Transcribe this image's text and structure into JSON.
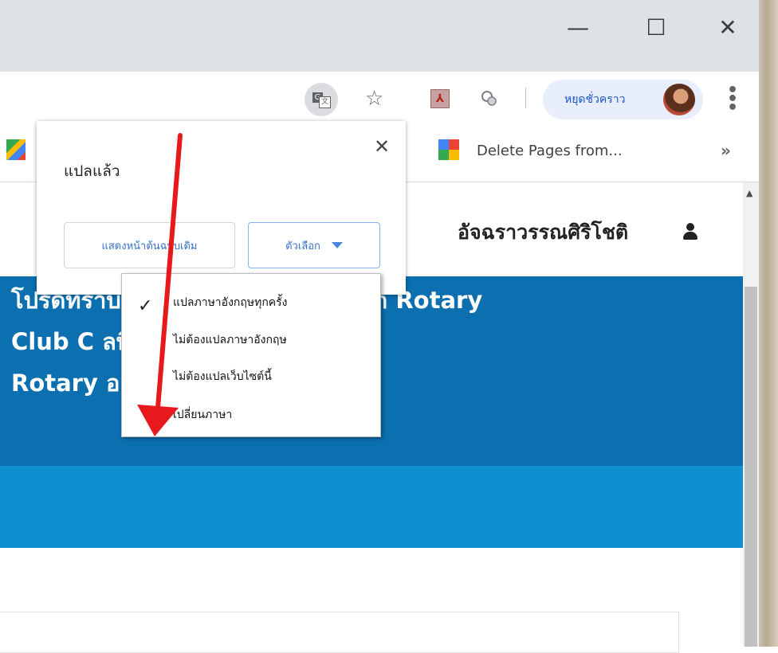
{
  "window": {
    "minimize_glyph": "—",
    "maximize_glyph": "☐",
    "close_glyph": "✕"
  },
  "toolbar": {
    "translate_icon_text_a": "G",
    "translate_icon_text_b": "文",
    "bookmark_star": "☆",
    "pdf_icon_text": "⅄",
    "profile_label": "หยุดชั่วคราว",
    "menu_glyph": "⋮"
  },
  "bookmarks": {
    "item_label": "Delete Pages from...",
    "more_glyph": "»"
  },
  "page": {
    "user_name": "อัจฉราวรรณศิริโชติ",
    "banner_lines": [
      "โปรดทราบว่าข้อมูลจากแหล่งภายนอก Rotary",
      "Club C                          ลที่รายงานใน My",
      "Rotary                         อย่างน้อย 24 ชั่วโมง"
    ],
    "scroll_up_glyph": "▲"
  },
  "translate_bubble": {
    "title": "แปลแล้ว",
    "close_glyph": "✕",
    "show_original_label": "แสดงหน้าต้นฉบับเดิม",
    "options_label": "ตัวเลือก"
  },
  "options_menu": {
    "check_glyph": "✓",
    "items": [
      "แปลภาษาอังกฤษทุกครั้ง",
      "ไม่ต้องแปลภาษาอังกฤษ",
      "ไม่ต้องแปลเว็บไซต์นี้",
      "เปลี่ยนภาษา"
    ],
    "checked_index": 0
  },
  "colors": {
    "banner_dark": "#0b6fb0",
    "banner_light": "#0f8fcf",
    "annotation_arrow": "#e8191c",
    "link_blue": "#3670c6"
  }
}
